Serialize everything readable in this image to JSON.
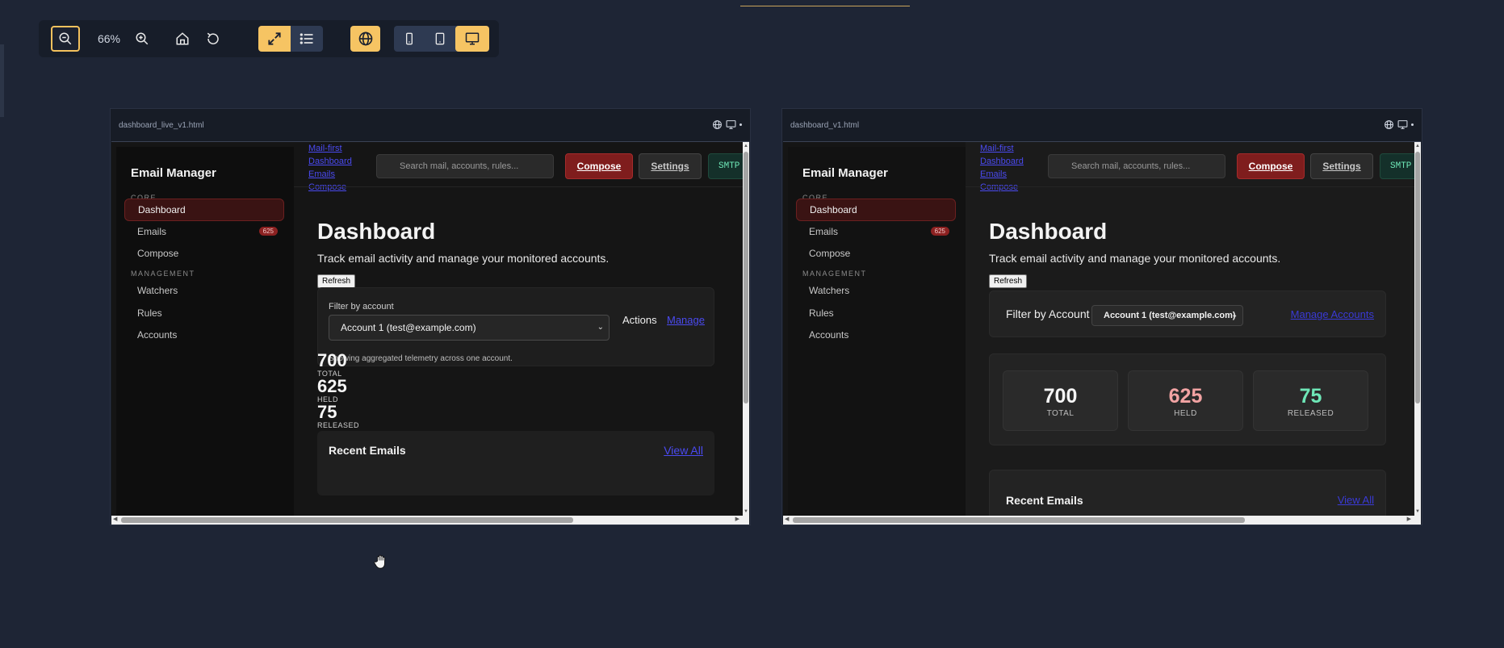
{
  "toolbar": {
    "zoom_level": "66%",
    "icons": [
      "zoom-out-icon",
      "zoom-in-icon",
      "home-icon",
      "reset-icon",
      "expand-icon",
      "list-icon",
      "globe-icon",
      "mobile-icon",
      "tablet-icon",
      "desktop-icon"
    ],
    "accent_color": "#f6c463"
  },
  "left_frame": {
    "filename": "dashboard_live_v1.html",
    "app": {
      "brand": "Email Manager",
      "section_core": "CORE",
      "section_management": "MANAGEMENT",
      "nav": [
        {
          "label": "Dashboard",
          "active": true
        },
        {
          "label": "Emails",
          "badge": "625"
        },
        {
          "label": "Compose"
        },
        {
          "label": "Watchers"
        },
        {
          "label": "Rules"
        },
        {
          "label": "Accounts"
        }
      ],
      "skip_links": [
        "Mail-first",
        "Dashboard",
        "Emails",
        "Compose"
      ],
      "search_placeholder": "Search mail, accounts, rules...",
      "compose_label": "Compose",
      "settings_label": "Settings",
      "smtp_label": "SMTP",
      "title": "Dashboard",
      "subtitle": "Track email activity and manage your monitored accounts.",
      "refresh_label": "Refresh",
      "filter_label": "Filter by account",
      "filter_value": "Account 1 (test@example.com)",
      "actions_label": "Actions",
      "manage_label": "Manage",
      "filter_hint": "Showing aggregated telemetry across one account.",
      "stats": [
        {
          "value": "700",
          "label": "TOTAL"
        },
        {
          "value": "625",
          "label": "HELD"
        },
        {
          "value": "75",
          "label": "RELEASED"
        }
      ],
      "recent_title": "Recent Emails",
      "view_all_label": "View All"
    }
  },
  "right_frame": {
    "filename": "dashboard_v1.html",
    "app": {
      "brand": "Email Manager",
      "section_core": "CORE",
      "section_management": "MANAGEMENT",
      "nav": [
        {
          "label": "Dashboard",
          "active": true
        },
        {
          "label": "Emails",
          "badge": "625"
        },
        {
          "label": "Compose"
        },
        {
          "label": "Watchers"
        },
        {
          "label": "Rules"
        },
        {
          "label": "Accounts"
        }
      ],
      "skip_links": [
        "Mail-first",
        "Dashboard",
        "Emails",
        "Compose"
      ],
      "search_placeholder": "Search mail, accounts, rules...",
      "compose_label": "Compose",
      "settings_label": "Settings",
      "smtp_label": "SMTP",
      "title": "Dashboard",
      "subtitle": "Track email activity and manage your monitored accounts.",
      "refresh_label": "Refresh",
      "filter_label": "Filter by Account",
      "filter_value": "Account 1 (test@example.com)",
      "manage_label": "Manage Accounts",
      "stats": [
        {
          "value": "700",
          "label": "TOTAL",
          "color": "#f5f5f5"
        },
        {
          "value": "625",
          "label": "HELD",
          "color": "#f2a3a3"
        },
        {
          "value": "75",
          "label": "RELEASED",
          "color": "#6ee7b7"
        }
      ],
      "recent_title": "Recent Emails",
      "view_all_label": "View All"
    }
  }
}
